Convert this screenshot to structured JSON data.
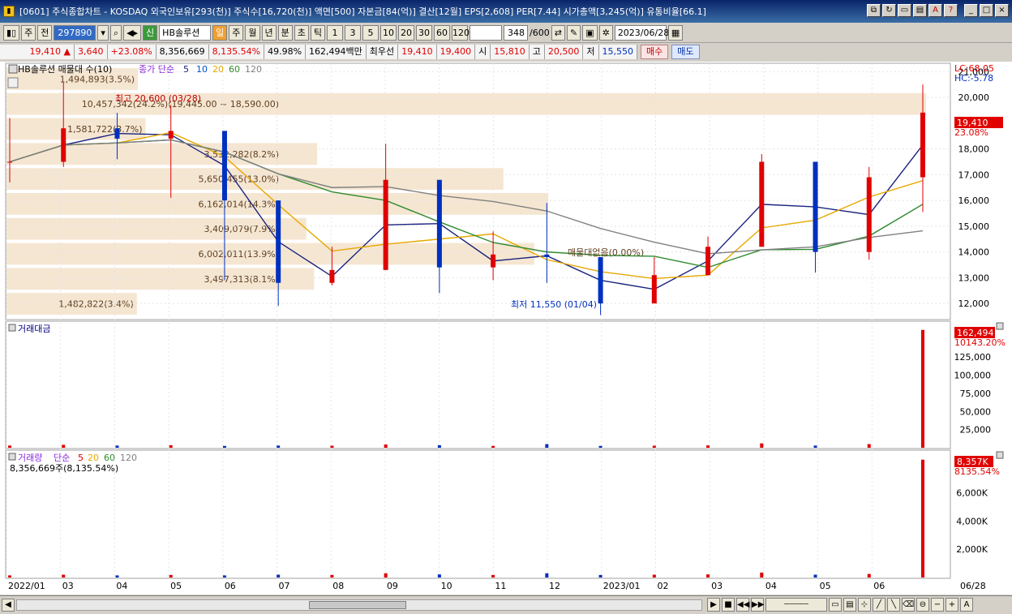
{
  "window": {
    "title": "[0601] 주식종합차트 - KOSDAQ 외국인보유[293(천)] 주식수[16,720(천)] 액면[500] 자본금[84(억)] 결산[12월] EPS[2,608] PER[7.44] 시가총액[3,245(억)] 유통비율[66.1]",
    "app_icon": "chart-app-icon"
  },
  "toolbar": {
    "period_select": "주",
    "prev_label": "전",
    "code": "297890",
    "stock_badge": "신",
    "stock_name": "HB솔루션",
    "period_tabs": [
      "일",
      "주",
      "월",
      "년",
      "분",
      "초",
      "틱"
    ],
    "active_period": "일",
    "intervals": [
      "1",
      "3",
      "5",
      "10",
      "20",
      "30",
      "60",
      "120"
    ],
    "count_value": "348",
    "count_total": "/600",
    "date": "2023/06/28"
  },
  "quote": {
    "price": "19,410",
    "change_arrow": "▲",
    "change": "3,640",
    "change_pct": "+23.08%",
    "volume": "8,356,669",
    "volume_ratio": "8,135.54%",
    "rotation": "49.98%",
    "amount": "162,494백만",
    "best_label": "최우선",
    "best_ask": "19,410",
    "best_bid": "19,400",
    "open_label": "시",
    "open": "15,810",
    "high_label": "고",
    "high": "20,500",
    "low_label": "저",
    "low": "15,550",
    "buy_label": "매수",
    "sell_label": "매도"
  },
  "price_panel": {
    "title": "HB솔루션 매물대 수(10)",
    "ma_label": "종가 단순",
    "ma_periods": [
      "5",
      "10",
      "20",
      "60",
      "120"
    ],
    "lc_label": "LC:68.05",
    "hc_label": "HC:-5.78",
    "y_ticks": [
      "21,000",
      "20,000",
      "18,000",
      "17,000",
      "16,000",
      "15,000",
      "14,000",
      "13,000",
      "12,000"
    ],
    "current_price": "19,410",
    "current_pct": "23.08%",
    "max_annotation": "최고 20,600 (03/28)",
    "min_annotation": "최저 11,550 (01/04)",
    "volume_profile": [
      {
        "label": "1,494,893(3.5%)",
        "value": 1494893
      },
      {
        "label": "10,457,342(24.2%)(19,445.00 ~ 18,590.00)",
        "value": 10457342
      },
      {
        "label": "1,581,722(3.7%)",
        "value": 1581722
      },
      {
        "label": "3,532,282(8.2%)",
        "value": 3532282
      },
      {
        "label": "5,650,455(13.0%)",
        "value": 5650455
      },
      {
        "label": "6,162,014(14.3%)",
        "value": 6162014
      },
      {
        "label": "3,409,079(7.9%)",
        "value": 3409079
      },
      {
        "label": "6,002,011(13.9%)",
        "value": 6002011
      },
      {
        "label": "3,497,313(8.1%)",
        "value": 3497313
      },
      {
        "label": "1,482,822(3.4%)",
        "value": 1482822
      }
    ],
    "zero_label": "매물대없음(0.00%)"
  },
  "amount_panel": {
    "title": "거래대금",
    "y_ticks": [
      "125,000",
      "100,000",
      "75,000",
      "50,000",
      "25,000"
    ],
    "current": "162,494",
    "current_sub": "10143.20%"
  },
  "volume_panel": {
    "title": "거래량",
    "ma_label": "단순",
    "ma_periods": [
      "5",
      "20",
      "60",
      "120"
    ],
    "sub_label": "8,356,669주(8,135.54%)",
    "y_ticks": [
      "6,000K",
      "4,000K",
      "2,000K"
    ],
    "current": "8,357K",
    "current_sub": "8135.54%"
  },
  "x_axis": {
    "labels": [
      "2022/01",
      "03",
      "04",
      "05",
      "06",
      "07",
      "08",
      "09",
      "10",
      "11",
      "12",
      "2023/01",
      "02",
      "03",
      "04",
      "05",
      "06"
    ],
    "end_label": "06/28"
  },
  "colors": {
    "up": "#e00000",
    "down": "#0030c0",
    "ma5": "#1a237e",
    "ma20": "#e6a800",
    "ma60": "#2e8b2e",
    "ma120": "#808080",
    "profile": "#f5e6d2"
  },
  "chart_data": {
    "type": "candlestick",
    "title": "HB솔루션",
    "x": [
      "2022/01",
      "2022/03",
      "2022/04",
      "2022/05",
      "2022/06",
      "2022/07",
      "2022/08",
      "2022/09",
      "2022/10",
      "2022/11",
      "2022/12",
      "2023/01",
      "2023/02",
      "2023/03",
      "2023/04",
      "2023/05",
      "2023/06",
      "2023/06/28"
    ],
    "close": [
      17500,
      18800,
      18400,
      18700,
      16000,
      12800,
      13300,
      16800,
      13400,
      13900,
      13800,
      12000,
      13100,
      14200,
      17500,
      14000,
      16900,
      19410
    ],
    "high": [
      19200,
      20600,
      19400,
      19700,
      17100,
      13900,
      14200,
      18200,
      15600,
      14800,
      15900,
      13200,
      13800,
      14600,
      17800,
      15200,
      17300,
      20500
    ],
    "low": [
      16700,
      17300,
      17600,
      16100,
      12900,
      11900,
      12700,
      13400,
      12400,
      12900,
      12800,
      11550,
      12600,
      13100,
      14300,
      13200,
      13700,
      15550
    ],
    "amount_millions": [
      3000,
      4000,
      3000,
      3500,
      2500,
      3000,
      2800,
      4500,
      3500,
      2500,
      5000,
      2500,
      2800,
      3200,
      6000,
      3000,
      5000,
      162494
    ],
    "volume_k": [
      150,
      200,
      150,
      180,
      150,
      200,
      180,
      300,
      220,
      180,
      300,
      180,
      200,
      220,
      350,
      200,
      250,
      8357
    ],
    "ylim": [
      11500,
      21200
    ],
    "volume_ylim": [
      0,
      8800
    ],
    "amount_ylim": [
      0,
      170000
    ]
  }
}
